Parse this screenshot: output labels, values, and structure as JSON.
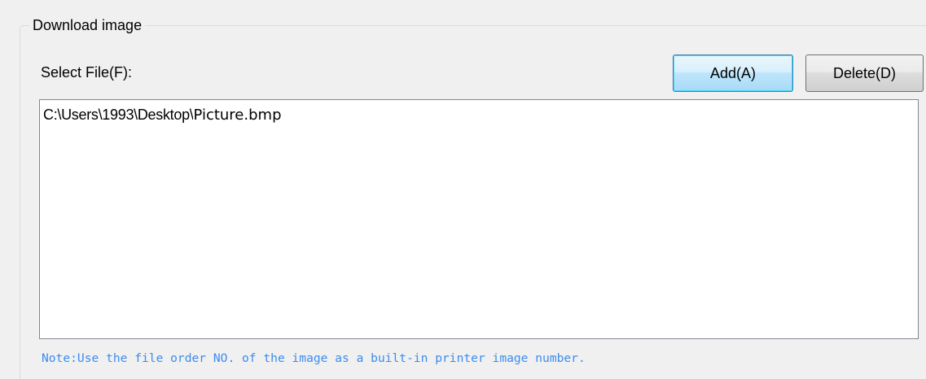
{
  "group": {
    "title": "Download image"
  },
  "select_file": {
    "label": "Select File(F):"
  },
  "buttons": {
    "add_label": "Add(A)",
    "delete_label": "Delete(D)"
  },
  "file_list": {
    "items": [
      {
        "directory": "C:\\Users\\1993\\Desktop\\",
        "filename": "Picture.bmp"
      }
    ]
  },
  "note": "Note:Use the file order NO. of the image as a built-in printer image number.",
  "colors": {
    "background": "#f0f0f0",
    "note_text": "#3c8cf0",
    "list_background": "#ffffff",
    "list_border": "#828790"
  }
}
